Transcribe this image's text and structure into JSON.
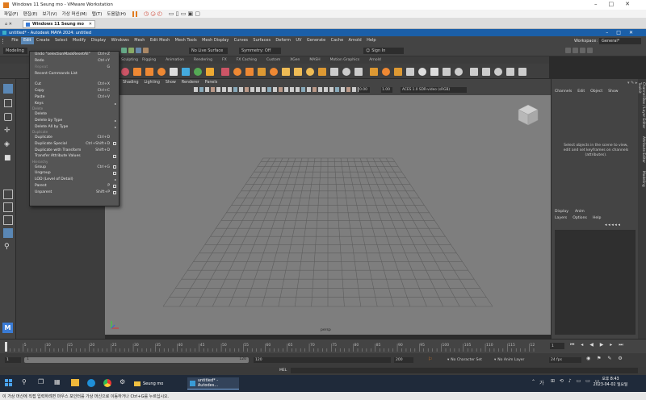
{
  "vmware": {
    "title": "Windows 11 Seung mo - VMware Workstation",
    "menu": [
      "파일(F)",
      "편집(E)",
      "보기(V)",
      "가상 머신(M)",
      "탭(T)",
      "도움말(H)"
    ],
    "tab_home": "",
    "tab_vm": "Windows 11 Seung mo"
  },
  "maya": {
    "title": "untitled* - Autodesk MAYA 2024: untitled",
    "menu": [
      "File",
      "Edit",
      "Create",
      "Select",
      "Modify",
      "Display",
      "Windows",
      "Mesh",
      "Edit Mesh",
      "Mesh Tools",
      "Mesh Display",
      "Curves",
      "Surfaces",
      "Deform",
      "UV",
      "Generate",
      "Cache",
      "Arnold",
      "Help"
    ],
    "workspace_label": "Workspace:",
    "workspace_value": "General*",
    "mode": "Modeling",
    "live_surface": "No Live Surface",
    "symmetry": "Symmetry: Off",
    "sign_in": "Sign In",
    "shelf_tabs": [
      "Rigging",
      "Animation",
      "Rendering",
      "FX",
      "FX Caching",
      "Custom",
      "XGen",
      "MASH",
      "Motion Graphics",
      "Arnold"
    ],
    "shelf_tab_partial": "Sculpting",
    "viewport_menu": [
      "Shading",
      "Lighting",
      "Show",
      "Renderer",
      "Panels"
    ],
    "exposure": "0.00",
    "gamma": "1.00",
    "colorspace": "ACES 1.0 SDR-video (sRGB)",
    "camera_label": "persp",
    "channel_tabs": [
      "Channels",
      "Edit",
      "Object",
      "Show"
    ],
    "channel_message": "Select objects in the scene to view, edit and set keyframes on channels (attributes).",
    "layer_tabs": [
      "Display",
      "Anim"
    ],
    "layer_menu": [
      "Layers",
      "Options",
      "Help"
    ],
    "side_tabs": [
      "Channel Box / Layer Editor",
      "Attribute Editor",
      "Modeling Toolkit"
    ],
    "time_ticks": [
      "5",
      "10",
      "15",
      "20",
      "25",
      "30",
      "35",
      "40",
      "45",
      "50",
      "55",
      "60",
      "65",
      "70",
      "75",
      "80",
      "85",
      "90",
      "95",
      "100",
      "105",
      "110",
      "115",
      "12"
    ],
    "current_frame": "1",
    "range_start": "1",
    "range_inner_start": "1",
    "range_inner_end": "120",
    "range_end": "120",
    "range_max": "200",
    "character_set": "No Character Set",
    "anim_layer": "No Anim Layer",
    "fps": "24 fps",
    "cmd_label": "MEL"
  },
  "edit_menu": [
    {
      "label": "Undo \"selectionMaskResetAll\"",
      "shortcut": "Ctrl+Z"
    },
    {
      "label": "Redo",
      "shortcut": "Ctrl+Y"
    },
    {
      "label": "Repeat",
      "shortcut": "G",
      "disabled": true
    },
    {
      "label": "Recent Commands List"
    },
    {
      "header": ""
    },
    {
      "label": "Cut",
      "shortcut": "Ctrl+X"
    },
    {
      "label": "Copy",
      "shortcut": "Ctrl+C"
    },
    {
      "label": "Paste",
      "shortcut": "Ctrl+V"
    },
    {
      "label": "Keys",
      "arrow": true
    },
    {
      "header": "Delete"
    },
    {
      "label": "Delete"
    },
    {
      "label": "Delete by Type",
      "arrow": true
    },
    {
      "label": "Delete All by Type",
      "arrow": true
    },
    {
      "header": "Duplicate"
    },
    {
      "label": "Duplicate",
      "shortcut": "Ctrl+D"
    },
    {
      "label": "Duplicate Special",
      "shortcut": "Ctrl+Shift+D",
      "option": true
    },
    {
      "label": "Duplicate with Transform",
      "shortcut": "Shift+D"
    },
    {
      "label": "Transfer Attribute Values",
      "option": true
    },
    {
      "header": "Hierarchy"
    },
    {
      "label": "Group",
      "shortcut": "Ctrl+G",
      "option": true
    },
    {
      "label": "Ungroup",
      "option": true
    },
    {
      "label": "LOD (Level of Detail)",
      "arrow": true
    },
    {
      "label": "Parent",
      "shortcut": "P",
      "option": true
    },
    {
      "label": "Unparent",
      "shortcut": "Shift+P",
      "option": true
    }
  ],
  "taskbar": {
    "search_icon": "search-icon",
    "app_explorer": "Seung mo",
    "app_maya": "untitled* - Autodes...",
    "lang": "가",
    "time": "오후 8:43",
    "date": "2023-04-02 일요일"
  },
  "statusline": "이 가상 머신에 직접 입력하려면 마우스 포인터를 가상 머신으로 이동하거나 Ctrl+G를 누르십시오."
}
